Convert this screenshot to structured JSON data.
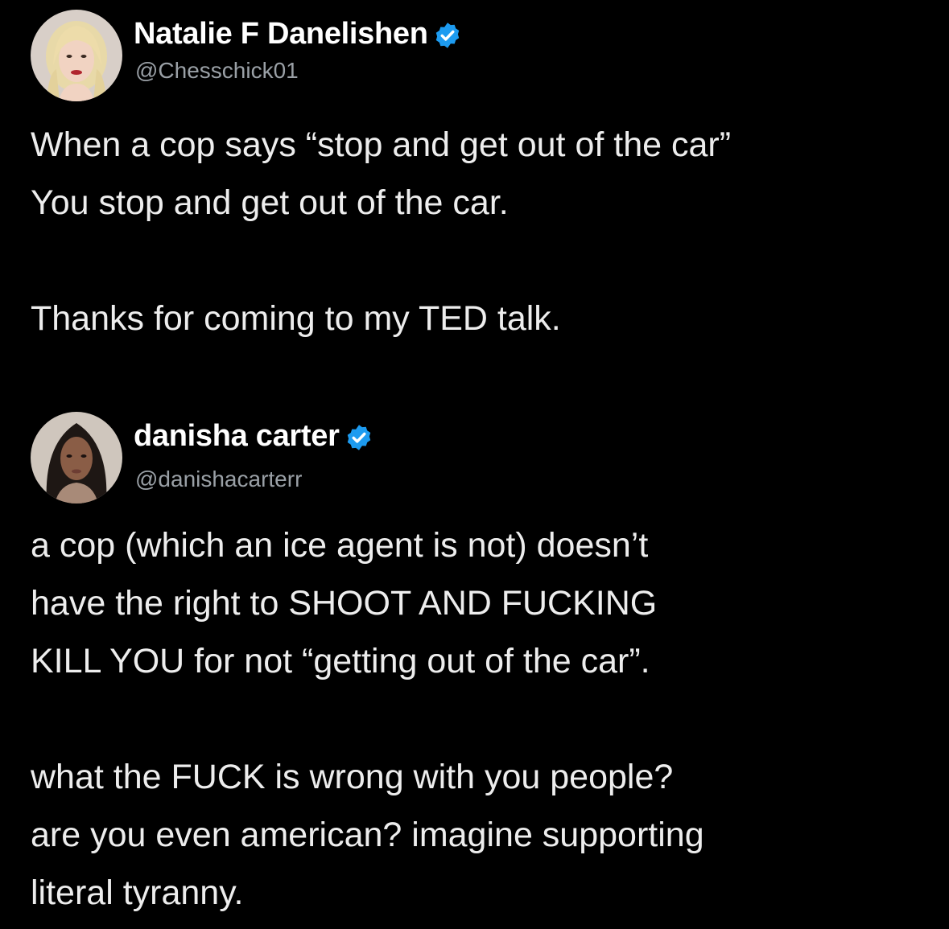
{
  "tweets": [
    {
      "author": {
        "display_name": "Natalie F Danelishen",
        "handle": "@Chesschick01",
        "verified": true,
        "avatar_icon": "avatar-photo-blonde-woman"
      },
      "body": {
        "paragraph1": [
          "When a cop says “stop and get out of the car”",
          "You stop and get out of the car."
        ],
        "paragraph2": [
          "Thanks for coming to my TED talk."
        ]
      }
    },
    {
      "author": {
        "display_name": "danisha carter",
        "handle": "@danishacarterr",
        "verified": true,
        "avatar_icon": "avatar-photo-dark-haired-woman"
      },
      "body": {
        "paragraph1": [
          "a cop (which an ice agent is not) doesn’t",
          "have the right to SHOOT AND FUCKING",
          "KILL YOU for not “getting out of the car”."
        ],
        "paragraph2": [
          "what the FUCK is wrong with you people?",
          "are you even american? imagine supporting",
          "literal tyranny."
        ]
      }
    }
  ],
  "colors": {
    "background": "#000000",
    "text": "#ededed",
    "handle": "#9aa0a6",
    "verified_badge": "#1d9bf0"
  }
}
